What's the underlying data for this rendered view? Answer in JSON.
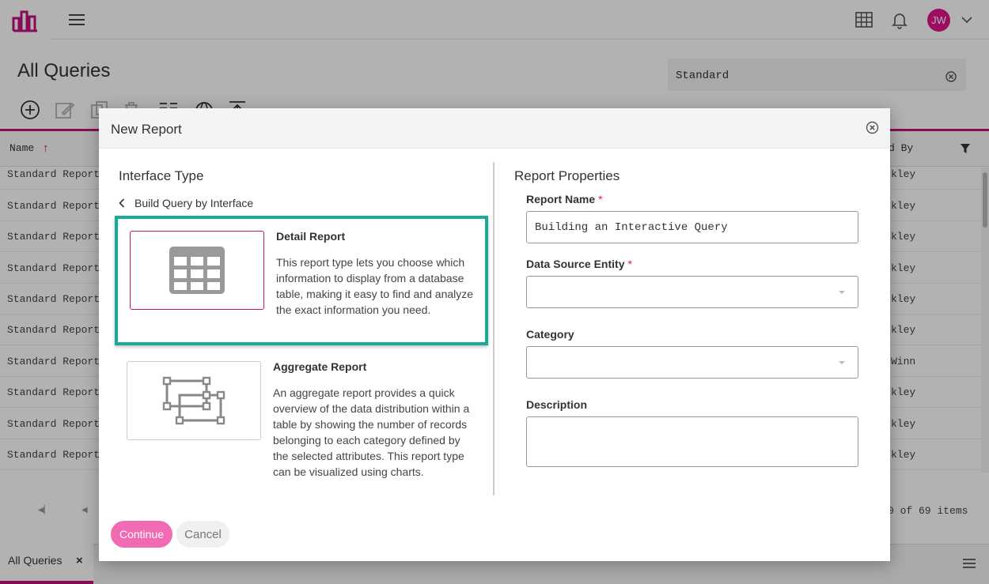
{
  "app": {
    "user_initials": "JW",
    "accent_color": "#c2127a",
    "avatar_color": "#e0128a",
    "selected_color": "#1aab98"
  },
  "page": {
    "title": "All Queries",
    "search_value": "Standard"
  },
  "grid": {
    "col_name": "Name",
    "col_by": "d By",
    "rows": [
      {
        "name": "Standard Report -",
        "by": "kley"
      },
      {
        "name": "Standard Report -",
        "by": "kley"
      },
      {
        "name": "Standard Report -",
        "by": "kley"
      },
      {
        "name": "Standard Report -",
        "by": "kley"
      },
      {
        "name": "Standard Report -",
        "by": "kley"
      },
      {
        "name": "Standard Report -",
        "by": "kley"
      },
      {
        "name": "Standard Report -",
        "by": "Winn"
      },
      {
        "name": "Standard Report -",
        "by": "kley"
      },
      {
        "name": "Standard Report -",
        "by": "kley"
      },
      {
        "name": "Standard Report -",
        "by": "kley"
      }
    ],
    "items_count": "0 of 69 items"
  },
  "bottom": {
    "tab_label": "All Queries",
    "tab_close": "×"
  },
  "modal": {
    "title": "New Report",
    "interface_type_title": "Interface Type",
    "back_label": "Build Query by Interface",
    "options": [
      {
        "title": "Detail Report",
        "description": "This report type lets you choose which information to display from a database table, making it easy to find and analyze the exact information you need."
      },
      {
        "title": "Aggregate Report",
        "description": "An aggregate report provides a quick overview of the data distribution within a table by showing the number of records belonging to each category defined by the selected attributes. This report type can be visualized using charts."
      }
    ],
    "properties_title": "Report Properties",
    "report_name_label": "Report Name",
    "report_name_value": "Building an Interactive Query",
    "data_source_label": "Data Source Entity",
    "data_source_value": "",
    "category_label": "Category",
    "category_value": "",
    "description_label": "Description",
    "description_value": "",
    "required_mark": "*",
    "continue_label": "Continue",
    "cancel_label": "Cancel"
  }
}
